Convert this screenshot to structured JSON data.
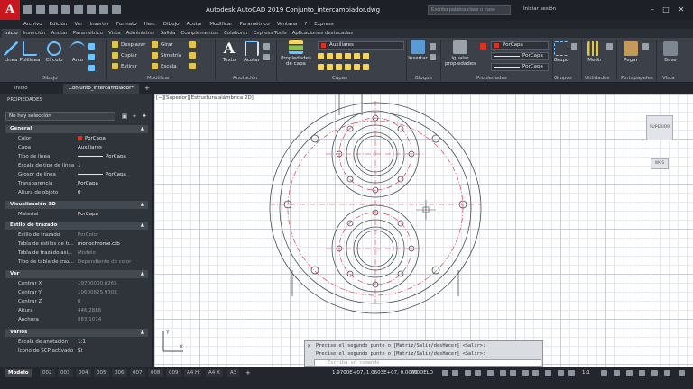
{
  "window": {
    "title": "Autodesk AutoCAD 2019    Conjunto_intercambiador.dwg",
    "search_placeholder": "Escriba palabra clave o frase",
    "signin": "Iniciar sesión"
  },
  "menubar": [
    "Archivo",
    "Edición",
    "Ver",
    "Insertar",
    "Formato",
    "Herr.",
    "Dibujo",
    "Acotar",
    "Modificar",
    "Paramétrico",
    "Ventana",
    "?",
    "Express"
  ],
  "ribbon_tabs": [
    "Inicio",
    "Inserción",
    "Anotar",
    "Paramétrico",
    "Vista",
    "Administrar",
    "Salida",
    "Complementos",
    "Colaborar",
    "Express Tools",
    "Aplicaciones destacadas"
  ],
  "ribbon": {
    "draw": {
      "line": "Línea",
      "polyline": "Polilínea",
      "circle": "Círculo",
      "arc": "Arco",
      "panel": "Dibujo"
    },
    "modify": {
      "move": "Desplazar",
      "rotate": "Girar",
      "copy": "Copiar",
      "mirror": "Simetría",
      "stretch": "Estirar",
      "scale": "Escala",
      "panel": "Modificar"
    },
    "annotation": {
      "text": "Texto",
      "dimension": "Acotar",
      "panel": "Anotación"
    },
    "layers": {
      "properties": "Propiedades",
      "properties2": "de capa",
      "current": "Auxiliares",
      "panel": "Capas"
    },
    "block": {
      "insert": "Insertar",
      "panel": "Bloque"
    },
    "properties": {
      "match": "Igualar",
      "match2": "propiedades",
      "color": "PorCapa",
      "linetype": "PorCapa",
      "lineweight": "PorCapa",
      "panel": "Propiedades"
    },
    "groups": {
      "group": "Grupo",
      "panel": "Grupos"
    },
    "utilities": {
      "measure": "Medir",
      "panel": "Utilidades"
    },
    "clipboard": {
      "paste": "Pegar",
      "panel": "Portapapeles"
    },
    "view": {
      "base": "Base",
      "panel": "Vista"
    }
  },
  "doc_tabs": {
    "start": "Inicio",
    "file": "Conjunto_intercambiador*"
  },
  "properties_palette": {
    "title": "PROPIEDADES",
    "selection": "No hay selección",
    "sections": [
      {
        "name": "General",
        "rows": [
          {
            "label": "Color",
            "value": "PorCapa",
            "kind": "color"
          },
          {
            "label": "Capa",
            "value": "Auxiliares"
          },
          {
            "label": "Tipo de línea",
            "value": "PorCapa",
            "kind": "line"
          },
          {
            "label": "Escala de tipo de línea",
            "value": "1"
          },
          {
            "label": "Grosor de línea",
            "value": "PorCapa",
            "kind": "line"
          },
          {
            "label": "Transparencia",
            "value": "PorCapa"
          },
          {
            "label": "Altura de objeto",
            "value": "0"
          }
        ]
      },
      {
        "name": "Visualización 3D",
        "rows": [
          {
            "label": "Material",
            "value": "PorCapa"
          }
        ]
      },
      {
        "name": "Estilo de trazado",
        "rows": [
          {
            "label": "Estilo de trazado",
            "value": "PorColor",
            "dim": true
          },
          {
            "label": "Tabla de estilos de tr...",
            "value": "monochrome.ctb"
          },
          {
            "label": "Tabla de trazado asi...",
            "value": "Modelo",
            "dim": true
          },
          {
            "label": "Tipo de tabla de traz...",
            "value": "Dependiente de color",
            "dim": true
          }
        ]
      },
      {
        "name": "Ver",
        "rows": [
          {
            "label": "Centrar X",
            "value": "19700000.0265",
            "dim": true
          },
          {
            "label": "Centrar Y",
            "value": "10600825.9308",
            "dim": true
          },
          {
            "label": "Centrar Z",
            "value": "0",
            "dim": true
          },
          {
            "label": "Altura",
            "value": "446.2886",
            "dim": true
          },
          {
            "label": "Anchura",
            "value": "883.1074",
            "dim": true
          }
        ]
      },
      {
        "name": "Varios",
        "rows": [
          {
            "label": "Escala de anotación",
            "value": "1:1"
          },
          {
            "label": "Icono de SCP activado",
            "value": "Sí"
          }
        ]
      }
    ]
  },
  "viewport": {
    "label": "[−][Superior][Estructura alámbrica 2D]",
    "viewcube": "SUPERIOR",
    "nav": "WCS",
    "ucs_x": "X",
    "ucs_y": "Y"
  },
  "command": {
    "history": [
      "Precise el segundo punto o [Matriz/Salir/desHacer] <Salir>:",
      "Precise el segundo punto o [Matriz/Salir/desHacer] <Salir>:"
    ],
    "input_placeholder": "Escriba un comando"
  },
  "layout_tabs": [
    "Modelo",
    "002",
    "003",
    "004",
    "005",
    "006",
    "007",
    "008",
    "009",
    "A4 H",
    "A4 X",
    "A3"
  ],
  "statusbar": {
    "coords": "1.9700E+07, 1.0603E+07, 0.0000",
    "model": "MODELO",
    "scale": "1:1"
  },
  "colors": {
    "accent": "#c8171e",
    "layer_red": "#e0301e",
    "drawing_line": "#4a4f58",
    "center_line": "#d9203a"
  }
}
